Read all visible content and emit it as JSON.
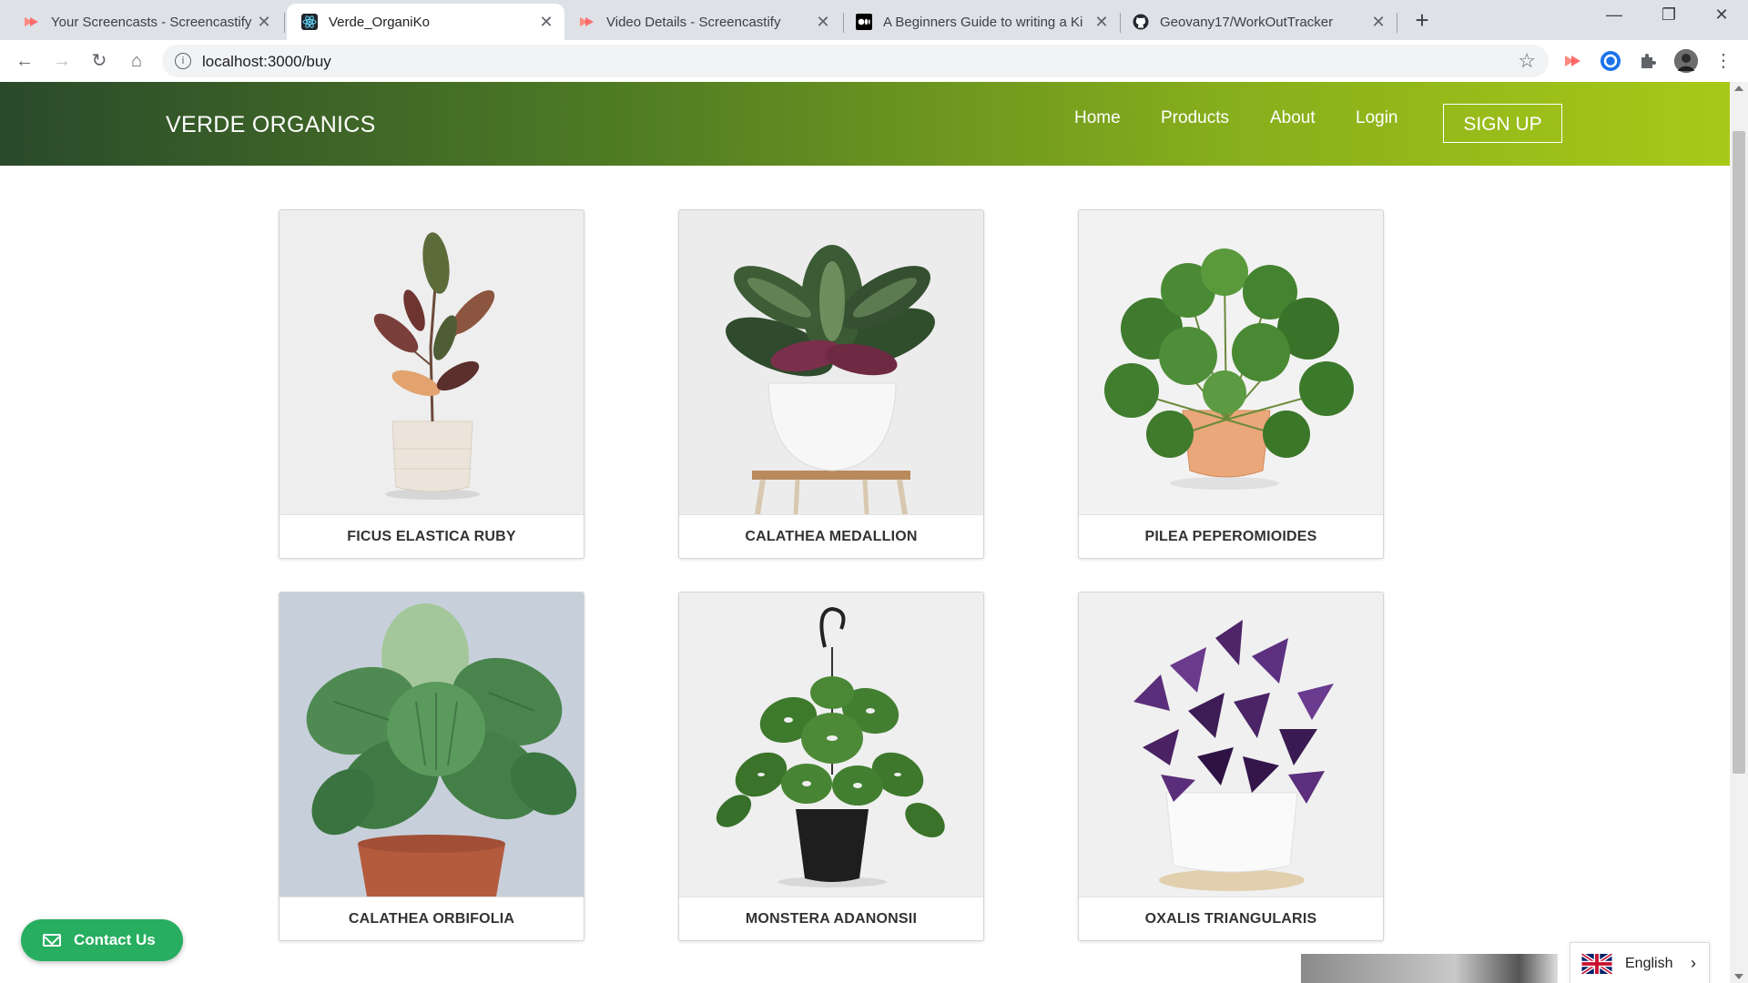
{
  "browser": {
    "tabs": [
      {
        "title": "Your Screencasts - Screencastify",
        "icon": "screencastify-icon"
      },
      {
        "title": "Verde_OrganiKo",
        "icon": "react-icon",
        "active": true
      },
      {
        "title": "Video Details - Screencastify",
        "icon": "screencastify-icon"
      },
      {
        "title": "A Beginners Guide to writing a Ki",
        "icon": "medium-icon"
      },
      {
        "title": "Geovany17/WorkOutTracker",
        "icon": "github-icon"
      }
    ],
    "url": "localhost:3000/buy"
  },
  "nav": {
    "brand": "VERDE ORGANICS",
    "links": [
      "Home",
      "Products",
      "About",
      "Login"
    ],
    "signup": "SIGN UP"
  },
  "products": [
    {
      "name": "FICUS ELASTICA RUBY",
      "bg": "#eeeeee"
    },
    {
      "name": "CALATHEA MEDALLION",
      "bg": "#ececec"
    },
    {
      "name": "PILEA PEPEROMIOIDES",
      "bg": "#f2f2f2"
    },
    {
      "name": "CALATHEA ORBIFOLIA",
      "bg": "#c7d0da"
    },
    {
      "name": "MONSTERA ADANONSII",
      "bg": "#efefef"
    },
    {
      "name": "OXALIS TRIANGULARIS",
      "bg": "#f0f0f0"
    }
  ],
  "widgets": {
    "contact": "Contact Us",
    "language": "English"
  },
  "colors": {
    "nav_gradient_start": "#2a4a2b",
    "nav_gradient_end": "#a7c918",
    "contact_green": "#27ae60"
  }
}
